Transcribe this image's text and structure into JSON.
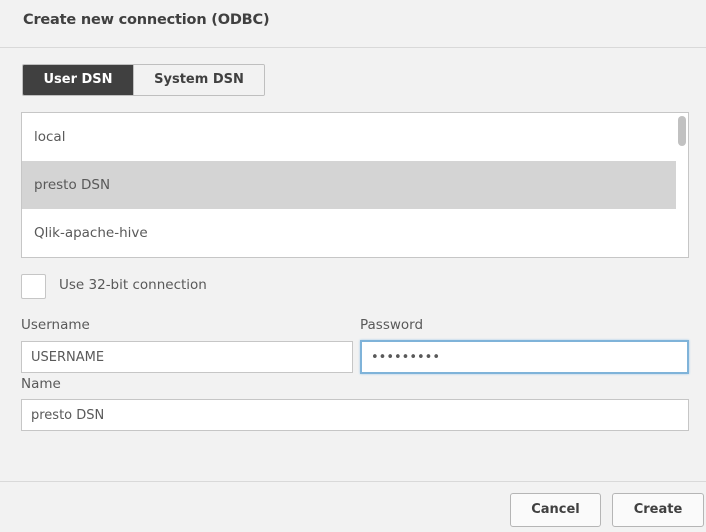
{
  "dialog": {
    "title": "Create new connection (ODBC)"
  },
  "tabs": [
    {
      "label": "User DSN",
      "active": true
    },
    {
      "label": "System DSN",
      "active": false
    }
  ],
  "dsn_list": {
    "items": [
      {
        "label": "local",
        "selected": false
      },
      {
        "label": "presto DSN",
        "selected": true
      },
      {
        "label": "Qlik-apache-hive",
        "selected": false
      }
    ]
  },
  "options": {
    "use_32bit_label": "Use 32-bit connection",
    "use_32bit_checked": false
  },
  "fields": {
    "username_label": "Username",
    "username_value": "USERNAME",
    "password_label": "Password",
    "password_value": "aaaaaaaaa",
    "name_label": "Name",
    "name_value": "presto DSN"
  },
  "buttons": {
    "cancel_label": "Cancel",
    "create_label": "Create"
  },
  "colors": {
    "active_tab_bg": "#404040",
    "selected_row_bg": "#d4d4d4",
    "focus_border": "#7fb3d9"
  }
}
